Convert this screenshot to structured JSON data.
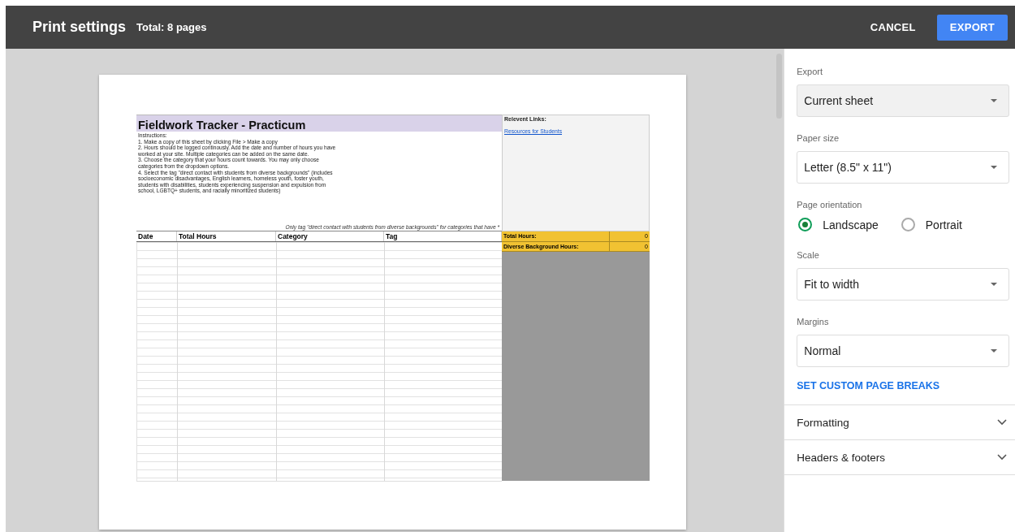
{
  "header": {
    "title": "Print settings",
    "subtitle": "Total: 8 pages",
    "buttons": [
      {
        "label": "CANCEL",
        "kind": "text"
      },
      {
        "label": "EXPORT",
        "kind": "primary"
      }
    ]
  },
  "sheet": {
    "title": "Fieldwork Tracker - Practicum",
    "instructions": [
      "Instructions:",
      "1. Make a copy of this sheet by clicking File > Make a copy",
      "2. Hours should be logged continously. Add the date and number of hours you have worked at your site. Multiple categories can be added on the same date.",
      "3. Choose the category that your hours count towards. You may only choose categories from the dropdown options.",
      "4. Select the tag \"direct contact with students from diverse backgrounds\" (includes socioeconomic disadvantages, English learners, homeless youth, foster youth, students with disabilities, students experiencing suspension and expulsion from school, LGBTQ+ students, and racially minoritized students)"
    ],
    "note": "Only tag \"direct contact with students from diverse backgrounds\" for categories that have *",
    "columns": [
      "Date",
      "Total Hours",
      "Category",
      "Tag"
    ],
    "links_title": "Relevent Links:",
    "link": "Resources for Students",
    "totals": [
      {
        "label": "Total Hours:",
        "value": "0"
      },
      {
        "label": "Diverse Background Hours:",
        "value": "0"
      }
    ]
  },
  "settings": [
    {
      "kind": "select",
      "label": "Export",
      "value": "Current sheet",
      "filled": true
    },
    {
      "kind": "select",
      "label": "Paper size",
      "value": "Letter (8.5\" x 11\")",
      "filled": false
    },
    {
      "kind": "radio",
      "label": "Page orientation",
      "options": [
        {
          "label": "Landscape",
          "selected": true
        },
        {
          "label": "Portrait",
          "selected": false
        }
      ]
    },
    {
      "kind": "select",
      "label": "Scale",
      "value": "Fit to width",
      "filled": false
    },
    {
      "kind": "select",
      "label": "Margins",
      "value": "Normal",
      "filled": false
    },
    {
      "kind": "link",
      "label": "SET CUSTOM PAGE BREAKS"
    }
  ],
  "sections": [
    {
      "label": "Formatting",
      "expanded": false
    },
    {
      "label": "Headers & footers",
      "expanded": false
    }
  ]
}
